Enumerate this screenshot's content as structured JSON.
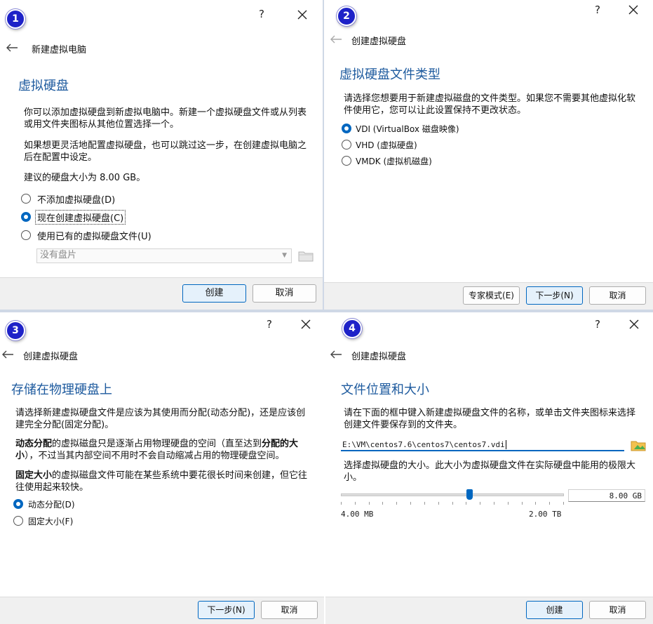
{
  "common": {
    "help": "?",
    "create": "创建",
    "cancel": "取消",
    "next": "下一步(N)",
    "create_disk_header": "创建虚拟硬盘"
  },
  "panel1": {
    "badge": "1",
    "header": "新建虚拟电脑",
    "title": "虚拟硬盘",
    "para1": "你可以添加虚拟硬盘到新虚拟电脑中。新建一个虚拟硬盘文件或从列表或用文件夹图标从其他位置选择一个。",
    "para2": "如果想更灵活地配置虚拟硬盘，也可以跳过这一步，在创建虚拟电脑之后在配置中设定。",
    "recommend": "建议的硬盘大小为 8.00 GB。",
    "options": [
      "不添加虚拟硬盘(D)",
      "现在创建虚拟硬盘(C)",
      "使用已有的虚拟硬盘文件(U)"
    ],
    "selected": 1,
    "combo": "没有盘片"
  },
  "panel2": {
    "badge": "2",
    "title": "虚拟硬盘文件类型",
    "para": "请选择您想要用于新建虚拟磁盘的文件类型。如果您不需要其他虚拟化软件使用它，您可以让此设置保持不更改状态。",
    "options": [
      "VDI (VirtualBox 磁盘映像)",
      "VHD (虚拟硬盘)",
      "VMDK (虚拟机磁盘)"
    ],
    "selected": 0,
    "expert": "专家模式(E)"
  },
  "panel3": {
    "badge": "3",
    "title": "存储在物理硬盘上",
    "para1": "请选择新建虚拟硬盘文件是应该为其使用而分配(动态分配)，还是应该创建完全分配(固定分配)。",
    "para2_bold": "动态分配",
    "para2_rest": "的虚拟磁盘只是逐渐占用物理硬盘的空间（直至达到",
    "para2_bold2": "分配的大小",
    "para2_rest2": "），不过当其内部空间不用时不会自动缩减占用的物理硬盘空间。",
    "para3_bold": "固定大小",
    "para3_rest": "的虚拟磁盘文件可能在某些系统中要花很长时间来创建，但它往往使用起来较快。",
    "options": [
      "动态分配(D)",
      "固定大小(F)"
    ],
    "selected": 0
  },
  "panel4": {
    "badge": "4",
    "title": "文件位置和大小",
    "para1": "请在下面的框中键入新建虚拟硬盘文件的名称，或单击文件夹图标来选择创建文件要保存到的文件夹。",
    "path": "E:\\VM\\centos7.6\\centos7\\centos7.vdi",
    "para2": "选择虚拟硬盘的大小。此大小为虚拟硬盘文件在实际硬盘中能用的极限大小。",
    "size_value": "8.00 GB",
    "min_label": "4.00 MB",
    "max_label": "2.00 TB",
    "slider_fraction": 0.5
  },
  "colors": {
    "accent": "#0067c0",
    "title": "#1d5a9e",
    "badge": "#1e22c8"
  }
}
